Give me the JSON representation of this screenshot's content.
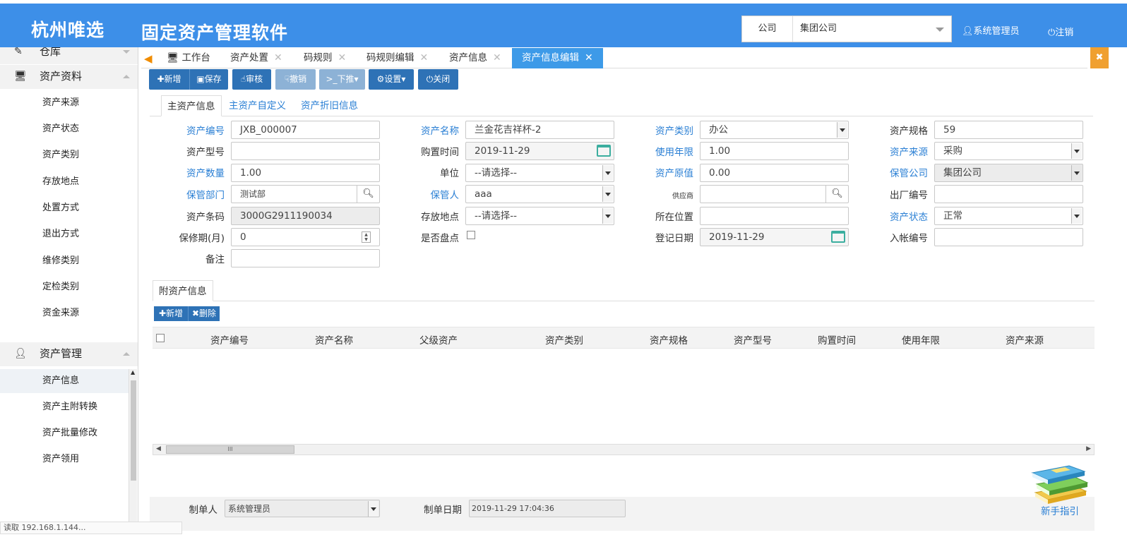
{
  "header": {
    "brand": "杭州唯选",
    "app_title": "固定资产管理软件",
    "company_label": "公司",
    "company_value": "集团公司",
    "user": "系统管理员",
    "logout": "注销"
  },
  "sidebar": {
    "groups": [
      {
        "label": "仓库",
        "icon": "edit-icon"
      },
      {
        "label": "资产资料",
        "icon": "monitor-icon"
      },
      {
        "label": "资产管理",
        "icon": "user-add-icon"
      }
    ],
    "asset_data_items": [
      "资产来源",
      "资产状态",
      "资产类别",
      "存放地点",
      "处置方式",
      "退出方式",
      "维修类别",
      "定检类别",
      "资金来源"
    ],
    "asset_mgmt_items": [
      "资产信息",
      "资产主附转换",
      "资产批量修改",
      "资产领用"
    ]
  },
  "tabs": [
    {
      "label": "工作台",
      "closable": false
    },
    {
      "label": "资产处置",
      "closable": true
    },
    {
      "label": "码规则",
      "closable": true
    },
    {
      "label": "码规则编辑",
      "closable": true
    },
    {
      "label": "资产信息",
      "closable": true
    },
    {
      "label": "资产信息编辑",
      "closable": true,
      "active": true
    }
  ],
  "toolbar": {
    "add": "新增",
    "save": "保存",
    "audit": "审核",
    "revoke": "撤销",
    "push_down": "下推",
    "settings": "设置",
    "close": "关闭"
  },
  "subtabs": [
    "主资产信息",
    "主资产自定义",
    "资产折旧信息"
  ],
  "form": {
    "asset_no": {
      "label": "资产编号",
      "value": "JXB_000007"
    },
    "asset_name": {
      "label": "资产名称",
      "value": "兰金花吉祥杯-2"
    },
    "asset_category": {
      "label": "资产类别",
      "value": "办公"
    },
    "asset_spec": {
      "label": "资产规格",
      "value": "59"
    },
    "asset_model": {
      "label": "资产型号",
      "value": ""
    },
    "purchase_date": {
      "label": "购置时间",
      "value": "2019-11-29"
    },
    "service_life": {
      "label": "使用年限",
      "value": "1.00"
    },
    "asset_source": {
      "label": "资产来源",
      "value": "采购"
    },
    "quantity": {
      "label": "资产数量",
      "value": "1.00"
    },
    "unit": {
      "label": "单位",
      "value": "--请选择--"
    },
    "original_value": {
      "label": "资产原值",
      "value": "0.00"
    },
    "custody_company": {
      "label": "保管公司",
      "value": "集团公司"
    },
    "custody_dept": {
      "label": "保管部门",
      "value": "测试部"
    },
    "custodian": {
      "label": "保管人",
      "value": "aaa"
    },
    "supplier": {
      "label": "供应商",
      "value": ""
    },
    "factory_no": {
      "label": "出厂编号",
      "value": ""
    },
    "barcode": {
      "label": "资产条码",
      "value": "3000G2911190034"
    },
    "location": {
      "label": "存放地点",
      "value": "--请选择--"
    },
    "position": {
      "label": "所在位置",
      "value": ""
    },
    "asset_status": {
      "label": "资产状态",
      "value": "正常"
    },
    "warranty": {
      "label": "保修期(月)",
      "value": "0"
    },
    "inventory": {
      "label": "是否盘点"
    },
    "register_date": {
      "label": "登记日期",
      "value": "2019-11-29"
    },
    "account_no": {
      "label": "入帐编号",
      "value": ""
    },
    "remark": {
      "label": "备注",
      "value": ""
    }
  },
  "sub_assets": {
    "title": "附资产信息",
    "add": "新增",
    "delete": "删除",
    "columns": [
      "资产编号",
      "资产名称",
      "父级资产",
      "资产类别",
      "资产规格",
      "资产型号",
      "购置时间",
      "使用年限",
      "资产来源"
    ],
    "scroll_thumb": "III"
  },
  "footer": {
    "creator_label": "制单人",
    "creator_value": "系统管理员",
    "date_label": "制单日期",
    "date_value": "2019-11-29 17:04:36",
    "guide": "新手指引"
  },
  "status_bar": "读取 192.168.1.144..."
}
